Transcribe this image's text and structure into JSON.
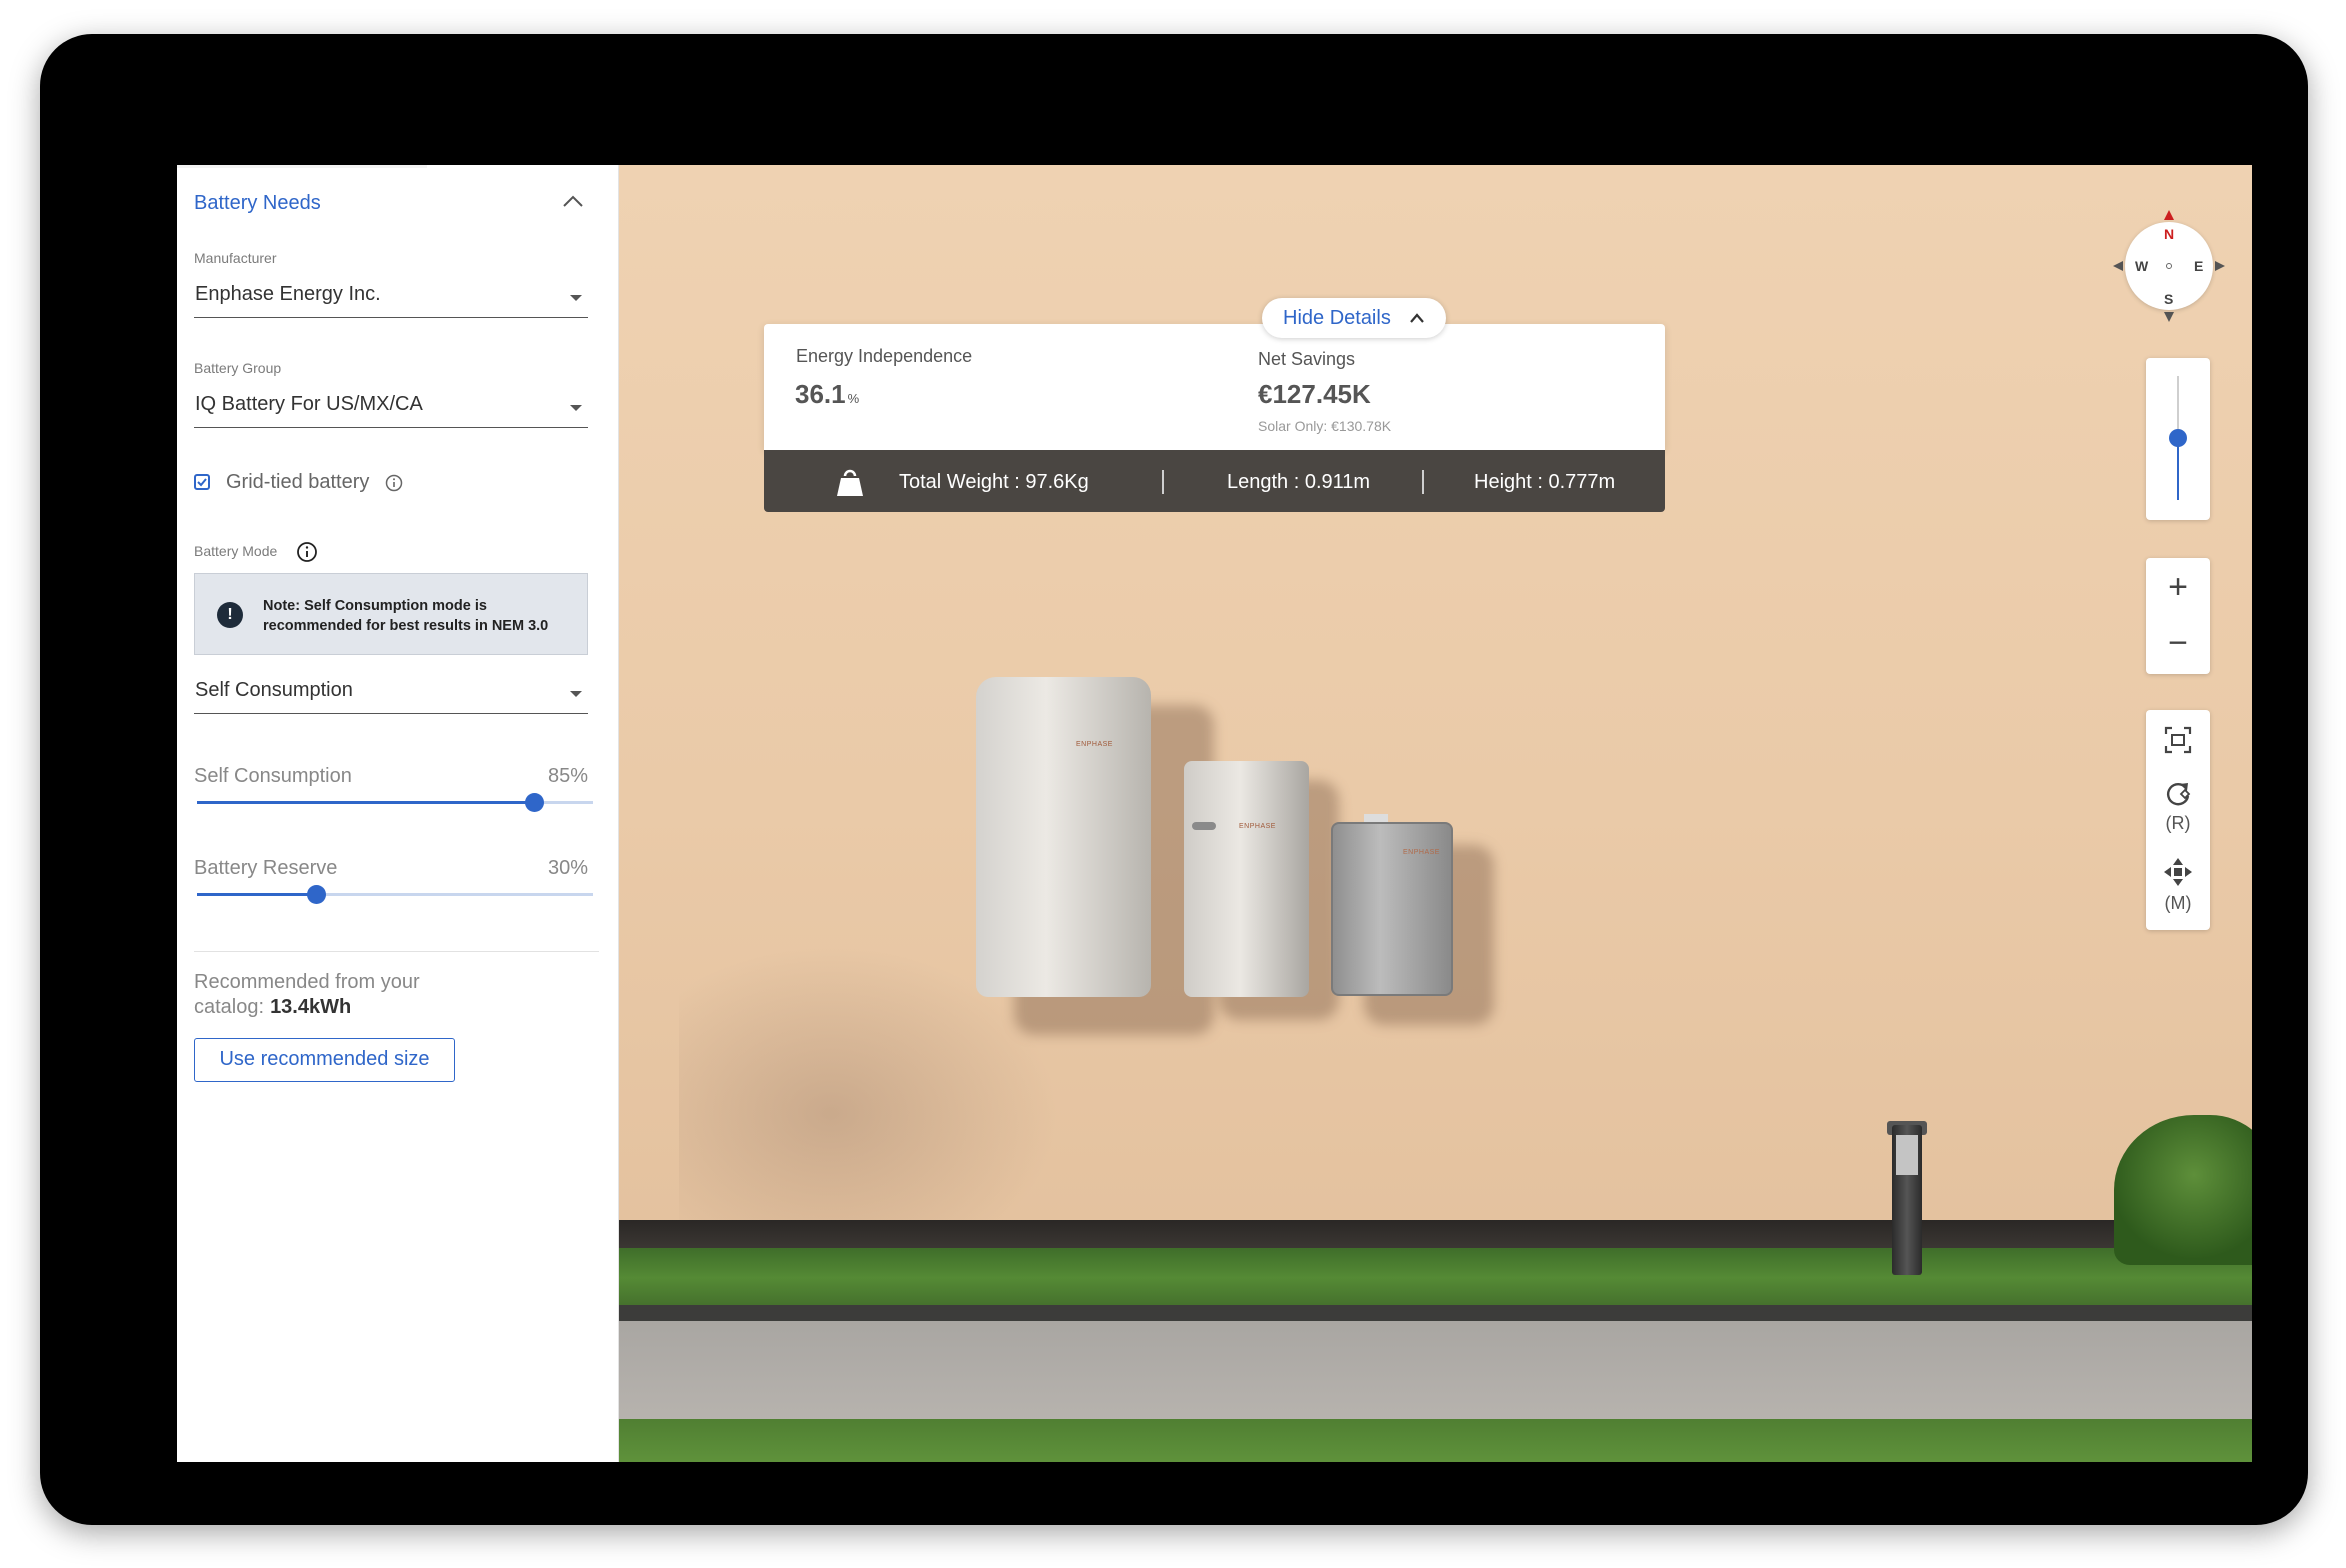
{
  "sidebar": {
    "title": "Battery Needs",
    "manufacturer_label": "Manufacturer",
    "manufacturer_value": "Enphase Energy Inc.",
    "group_label": "Battery Group",
    "group_value": "IQ Battery For US/MX/CA",
    "grid_tied_label": "Grid-tied battery",
    "grid_tied_checked": true,
    "mode_label": "Battery Mode",
    "note_icon": "!",
    "note_text": "Note: Self Consumption mode is recommended for best results in NEM 3.0",
    "mode_value": "Self Consumption",
    "sliders": [
      {
        "label": "Self Consumption",
        "value_text": "85%",
        "value": 0.85
      },
      {
        "label": "Battery Reserve",
        "value_text": "30%",
        "value": 0.3
      }
    ],
    "recommended_text": "Recommended from your catalog:",
    "recommended_value": "13.4kWh",
    "recommended_button": "Use recommended size"
  },
  "details": {
    "hide_label": "Hide Details",
    "energy_label": "Energy Independence",
    "energy_value": "36.1",
    "energy_unit": "%",
    "savings_label": "Net Savings",
    "savings_value": "€127.45K",
    "savings_sub": "Solar Only: €130.78K",
    "weight_text": "Total Weight : 97.6Kg",
    "length_text": "Length : 0.911m",
    "height_text": "Height : 0.777m"
  },
  "scene": {
    "brand_text": "ENPHASE"
  },
  "controls": {
    "compass": {
      "n": "N",
      "s": "S",
      "e": "E",
      "w": "W"
    },
    "vertical_slider_value": 0.5,
    "zoom_in": "+",
    "zoom_out": "−",
    "rotate_label": "(R)",
    "move_label": "(M)"
  },
  "colors": {
    "accent": "#2f66c9",
    "bar_background": "#4a4642",
    "wall": "#efd2b2"
  }
}
